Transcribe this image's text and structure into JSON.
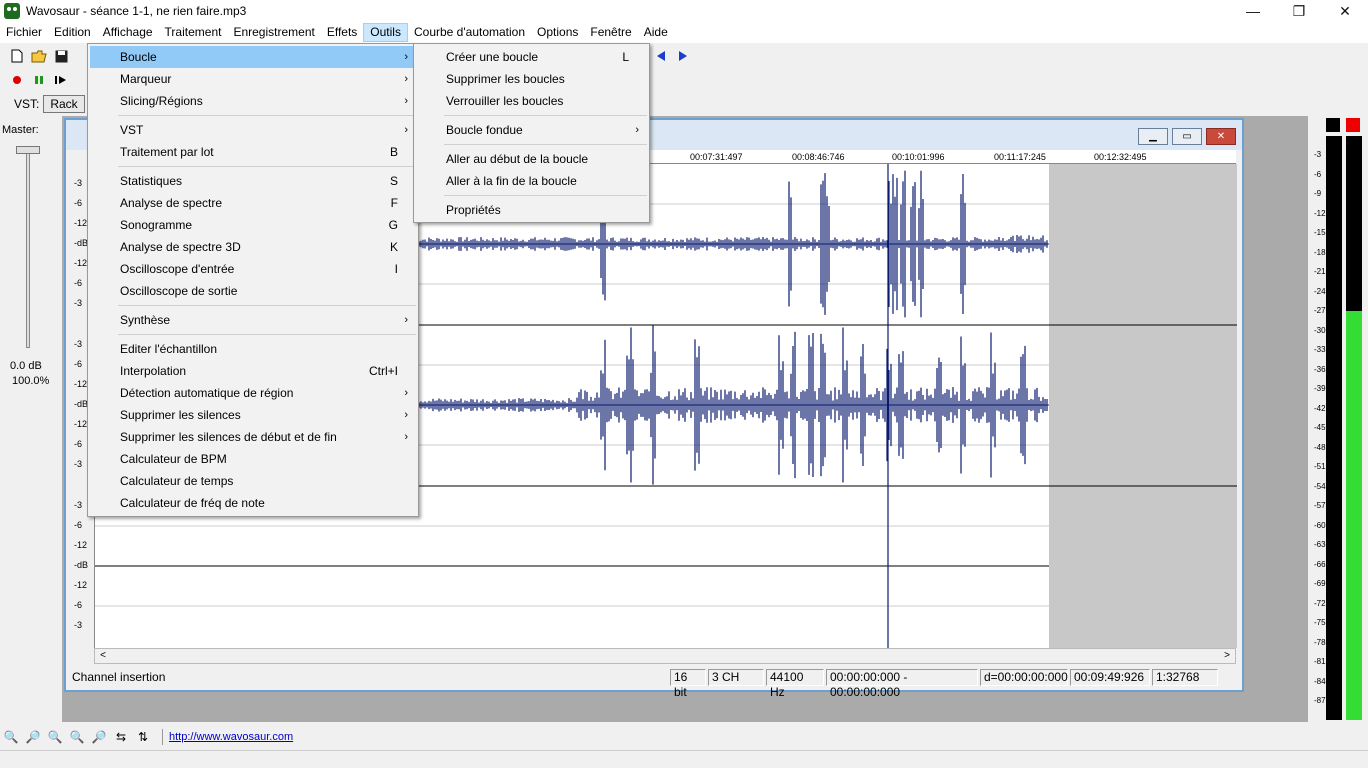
{
  "window": {
    "title": "Wavosaur - séance 1-1, ne rien faire.mp3",
    "minimize": "—",
    "maximize": "❐",
    "close": "✕"
  },
  "menubar": [
    "Fichier",
    "Edition",
    "Affichage",
    "Traitement",
    "Enregistrement",
    "Effets",
    "Outils",
    "Courbe d'automation",
    "Options",
    "Fenêtre",
    "Aide"
  ],
  "toolbar": {
    "vst_label": "VST:",
    "rack_label": "Rack"
  },
  "master": {
    "label": "Master:",
    "db": "0.0 dB",
    "percent": "100.0%"
  },
  "tools_menu": [
    {
      "label": "Boucle",
      "shortcut": "",
      "submenu": true
    },
    {
      "label": "Marqueur",
      "shortcut": "",
      "submenu": true
    },
    {
      "label": "Slicing/Régions",
      "shortcut": "",
      "submenu": true
    },
    {
      "label": "VST",
      "shortcut": "",
      "submenu": true
    },
    {
      "label": "Traitement par lot",
      "shortcut": "B",
      "submenu": false
    },
    {
      "label": "Statistiques",
      "shortcut": "S",
      "submenu": false
    },
    {
      "label": "Analyse de spectre",
      "shortcut": "F",
      "submenu": false
    },
    {
      "label": "Sonogramme",
      "shortcut": "G",
      "submenu": false
    },
    {
      "label": "Analyse de spectre 3D",
      "shortcut": "K",
      "submenu": false
    },
    {
      "label": "Oscilloscope d'entrée",
      "shortcut": "I",
      "submenu": false
    },
    {
      "label": "Oscilloscope de sortie",
      "shortcut": "",
      "submenu": false
    },
    {
      "label": "Synthèse",
      "shortcut": "",
      "submenu": true
    },
    {
      "label": "Editer l'échantillon",
      "shortcut": "",
      "submenu": false
    },
    {
      "label": "Interpolation",
      "shortcut": "Ctrl+I",
      "submenu": false
    },
    {
      "label": "Détection automatique de région",
      "shortcut": "",
      "submenu": true
    },
    {
      "label": "Supprimer les silences",
      "shortcut": "",
      "submenu": true
    },
    {
      "label": "Supprimer les silences de début et de fin",
      "shortcut": "",
      "submenu": true
    },
    {
      "label": "Calculateur de BPM",
      "shortcut": "",
      "submenu": false
    },
    {
      "label": "Calculateur de temps",
      "shortcut": "",
      "submenu": false
    },
    {
      "label": "Calculateur de fréq de note",
      "shortcut": "",
      "submenu": false
    }
  ],
  "loop_menu": [
    {
      "label": "Créer une boucle",
      "shortcut": "L",
      "submenu": false
    },
    {
      "label": "Supprimer les boucles",
      "shortcut": "",
      "submenu": false
    },
    {
      "label": "Verrouiller les boucles",
      "shortcut": "",
      "submenu": false
    },
    {
      "label": "Boucle fondue",
      "shortcut": "",
      "submenu": true
    },
    {
      "label": "Aller au début de la boucle",
      "shortcut": "",
      "submenu": false
    },
    {
      "label": "Aller à la fin de la boucle",
      "shortcut": "",
      "submenu": false
    },
    {
      "label": "Propriétés",
      "shortcut": "",
      "submenu": false
    }
  ],
  "timeline": [
    "00:07:31:497",
    "00:08:46:746",
    "00:10:01:996",
    "00:11:17:245",
    "00:12:32:495"
  ],
  "db_scale": [
    "-3",
    "-6",
    "-12",
    "-dB",
    "-12",
    "-6",
    "-3",
    "-3",
    "-6",
    "-12",
    "-dB",
    "-12",
    "-6",
    "-3",
    "-3",
    "-6",
    "-12",
    "-dB",
    "-12",
    "-6",
    "-3"
  ],
  "status": {
    "left": "Channel insertion",
    "bits": "16 bit",
    "channels": "3 CH",
    "rate": "44100 Hz",
    "selection": "00:00:00:000 - 00:00:00:000",
    "duration": "d=00:00:00:000",
    "position": "00:09:49:926",
    "zoom": "1:32768"
  },
  "meter_scale": [
    "-3",
    "-6",
    "-9",
    "-12",
    "-15",
    "-18",
    "-21",
    "-24",
    "-27",
    "-30",
    "-33",
    "-36",
    "-39",
    "-42",
    "-45",
    "-48",
    "-51",
    "-54",
    "-57",
    "-60",
    "-63",
    "-66",
    "-69",
    "-72",
    "-75",
    "-78",
    "-81",
    "-84",
    "-87"
  ],
  "meter_level": {
    "left": 0,
    "right": 0.7
  },
  "bottom": {
    "link": "http://www.wavosaur.com"
  },
  "colors": {
    "wave": "#0a1a6e",
    "highlight": "#91c9f7",
    "meter_green": "#33dd33"
  }
}
